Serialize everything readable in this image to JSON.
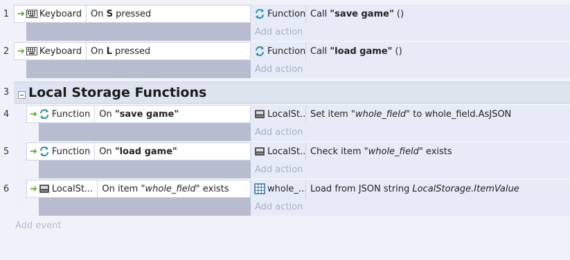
{
  "colors": {
    "condition_bg": "#ffffff",
    "condition_fill": "#b7bdcf",
    "action_bg": "#e6ebf7",
    "group_bg": "#dde4f0",
    "arrow": "#5aa51f"
  },
  "events": [
    {
      "num": "1",
      "cond_object": "Keyboard",
      "cond_icon": "keyboard-icon",
      "cond_pre": "On ",
      "cond_bold": "S",
      "cond_post": " pressed",
      "act_object": "Function",
      "act_icon": "function-icon",
      "act_pre": "Call ",
      "act_bold": "\"save game\"",
      "act_post": " ()",
      "add_action": "Add action"
    },
    {
      "num": "2",
      "cond_object": "Keyboard",
      "cond_icon": "keyboard-icon",
      "cond_pre": "On ",
      "cond_bold": "L",
      "cond_post": " pressed",
      "act_object": "Function",
      "act_icon": "function-icon",
      "act_pre": "Call ",
      "act_bold": "\"load game\"",
      "act_post": " ()",
      "add_action": "Add action"
    },
    {
      "num": "4",
      "cond_object": "Function",
      "cond_icon": "function-icon",
      "cond_pre": "On ",
      "cond_bold": "\"save game\"",
      "act_object": "LocalSt...",
      "act_icon": "local-storage-icon",
      "act_pre": "Set item ",
      "act_italic": "\"whole_field\"",
      "act_post": " to whole_field.AsJSON",
      "add_action": "Add action"
    },
    {
      "num": "5",
      "cond_object": "Function",
      "cond_icon": "function-icon",
      "cond_pre": "On ",
      "cond_bold": "\"load game\"",
      "act_object": "LocalSt...",
      "act_icon": "local-storage-icon",
      "act_pre": "Check item ",
      "act_italic": "\"whole_field\"",
      "act_post": " exists",
      "add_action": "Add action"
    },
    {
      "num": "6",
      "cond_object": "LocalSt...",
      "cond_icon": "local-storage-icon",
      "cond_pre": "On item ",
      "cond_italic": "\"whole_field\"",
      "cond_post": " exists",
      "act_object": "whole_...",
      "act_icon": "array-icon",
      "act_pre": "Load from JSON string ",
      "act_italic": "LocalStorage.ItemValue",
      "add_action": "Add action"
    }
  ],
  "group": {
    "num": "3",
    "title": "Local Storage Functions"
  },
  "add_event": "Add event"
}
